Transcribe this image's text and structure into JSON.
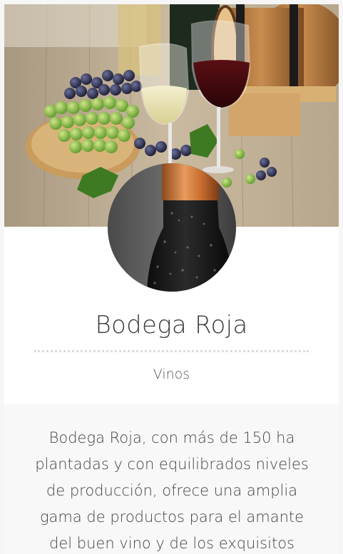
{
  "header": {
    "hero_image": "wine-grapes-barrel-photo",
    "logo_image": "wine-bottle-photo"
  },
  "business": {
    "name": "Bodega Roja",
    "category": "Vinos",
    "description": "Bodega Roja, con más de 150 ha plantadas y con equilibrados niveles de producción, ofrece una amplia gama de productos para el amante del buen vino y de los exquisitos"
  },
  "colors": {
    "background": "#f6f6f6",
    "card": "#ffffff",
    "text": "#3a3a3a",
    "divider": "#dcdcdc"
  }
}
